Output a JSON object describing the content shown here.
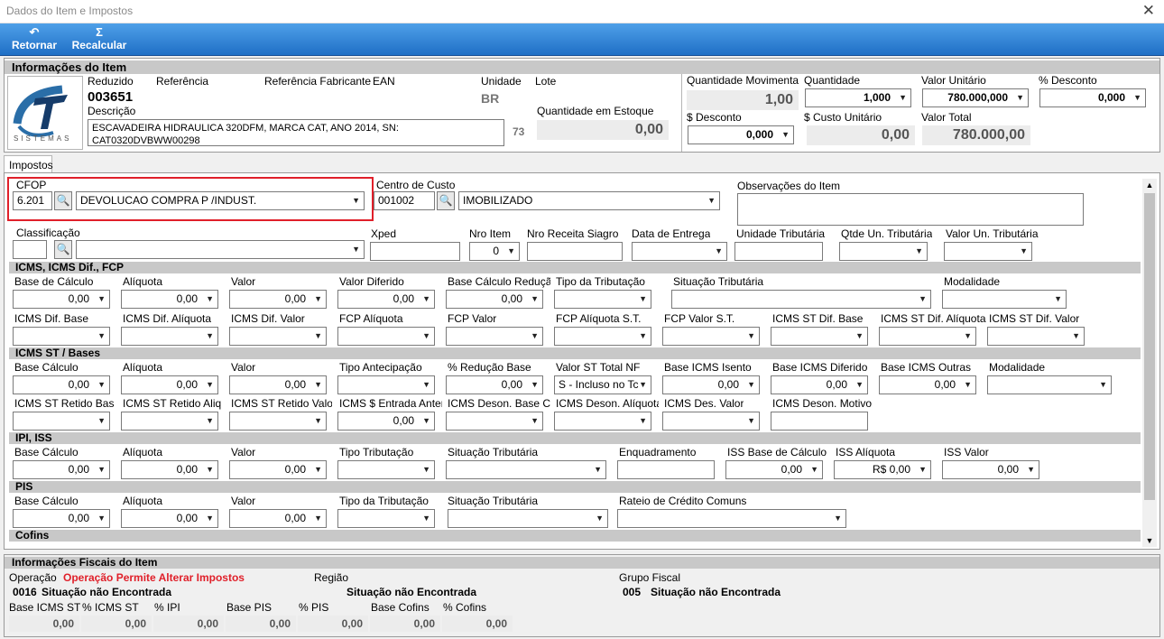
{
  "window": {
    "title": "Dados do Item e Impostos",
    "close": "✕"
  },
  "toolbar": {
    "retornar": "Retornar",
    "recalcular": "Recalcular"
  },
  "item": {
    "header": "Informações do Item",
    "logo_text": "SISTEMAS",
    "reduzido_label": "Reduzido",
    "reduzido": "003651",
    "referencia_label": "Referência",
    "ref_fab_label": "Referência Fabricante",
    "ean_label": "EAN",
    "unidade_label": "Unidade",
    "unidade": "BR",
    "lote_label": "Lote",
    "descricao_label": "Descrição",
    "descricao": "ESCAVADEIRA HIDRAULICA 320DFM, MARCA CAT, ANO 2014, SN: CAT0320DVBWW00298",
    "desc_count": "73",
    "qtd_estoque_label": "Quantidade em Estoque",
    "qtd_estoque": "0,00"
  },
  "values": {
    "qtd_mov_label": "Quantidade Movimenta",
    "qtd_mov": "1,00",
    "qtd_label": "Quantidade",
    "qtd": "1,000",
    "vu_label": "Valor Unitário",
    "vu": "780.000,000",
    "desc_pct_label": "% Desconto",
    "desc_pct": "0,000",
    "desc_val_label": "$ Desconto",
    "desc_val": "0,000",
    "custo_label": "$ Custo Unitário",
    "custo": "0,00",
    "total_label": "Valor Total",
    "total": "780.000,00"
  },
  "tabs": {
    "impostos": "Impostos"
  },
  "top": {
    "cfop_label": "CFOP",
    "cfop_code": "6.201",
    "cfop_desc": "DEVOLUCAO COMPRA P /INDUST.",
    "cc_label": "Centro de Custo",
    "cc_code": "001002",
    "cc_desc": "IMOBILIZADO",
    "obs_label": "Observações do Item",
    "class_label": "Classificação",
    "xped_label": "Xped",
    "nro_item_label": "Nro Item",
    "nro_item": "0",
    "nro_rec_label": "Nro Receita Siagro",
    "data_ent_label": "Data de Entrega",
    "un_trib_label": "Unidade Tributária",
    "qtde_un_trib_label": "Qtde Un. Tributária",
    "valor_un_trib_label": "Valor Un. Tributária"
  },
  "icms": {
    "title": "ICMS, ICMS Dif., FCP",
    "base_label": "Base de Cálculo",
    "base": "0,00",
    "aliq_label": "Alíquota",
    "aliq": "0,00",
    "valor_label": "Valor",
    "valor": "0,00",
    "vdif_label": "Valor Diferido",
    "vdif": "0,00",
    "bred_label": "Base Cálculo Redução",
    "bred": "0,00",
    "tipo_label": "Tipo da Tributação",
    "sit_label": "Situação Tributária",
    "mod_label": "Modalidade",
    "dbase_label": "ICMS Dif. Base",
    "daliq_label": "ICMS Dif. Alíquota",
    "dvalor_label": "ICMS Dif. Valor",
    "fcpaliq_label": "FCP Alíquota",
    "fcpvalor_label": "FCP Valor",
    "fcpst_aliq_label": "FCP Alíquota S.T.",
    "fcpst_valor_label": "FCP Valor S.T.",
    "stdifbase_label": "ICMS ST Dif. Base",
    "stdifaliq_label": "ICMS ST Dif. Alíquota",
    "stdifvalor_label": "ICMS ST Dif. Valor"
  },
  "icmsst": {
    "title": "ICMS ST / Bases",
    "base_label": "Base Cálculo",
    "base": "0,00",
    "aliq_label": "Alíquota",
    "aliq": "0,00",
    "valor_label": "Valor",
    "valor": "0,00",
    "tipoant_label": "Tipo Antecipação",
    "pred_label": "% Redução Base",
    "pred": "0,00",
    "vstnf_label": "Valor ST Total NF",
    "vstnf": "S - Incluso no Tc",
    "bisento_label": "Base ICMS Isento",
    "bisento": "0,00",
    "bdif_label": "Base ICMS Diferido",
    "bdif": "0,00",
    "boutras_label": "Base ICMS Outras",
    "boutras": "0,00",
    "mod_label": "Modalidade",
    "retbase_label": "ICMS ST Retido Base",
    "retaliq_label": "ICMS ST Retido Aliq.",
    "retvalor_label": "ICMS ST Retido Valor",
    "entant_label": "ICMS $ Entrada Anter",
    "entant": "0,00",
    "desonbase_label": "ICMS Deson. Base Cálc",
    "desonaliq_label": "ICMS Deson. Alíquota",
    "desvalor_label": "ICMS Des. Valor",
    "desonmot_label": "ICMS Deson. Motivo"
  },
  "ipi": {
    "title": "IPI, ISS",
    "base_label": "Base Cálculo",
    "base": "0,00",
    "aliq_label": "Alíquota",
    "aliq": "0,00",
    "valor_label": "Valor",
    "valor": "0,00",
    "tipo_label": "Tipo Tributação",
    "sit_label": "Situação Tributária",
    "enq_label": "Enquadramento",
    "issbase_label": "ISS Base de Cálculo",
    "issbase": "0,00",
    "issaliq_label": "ISS Alíquota",
    "issaliq": "R$ 0,00",
    "issvalor_label": "ISS Valor",
    "issvalor": "0,00"
  },
  "pis": {
    "title": "PIS",
    "base_label": "Base Cálculo",
    "base": "0,00",
    "aliq_label": "Alíquota",
    "aliq": "0,00",
    "valor_label": "Valor",
    "valor": "0,00",
    "tipo_label": "Tipo da Tributação",
    "sit_label": "Situação Tributária",
    "rateio_label": "Rateio de Crédito Comuns"
  },
  "cofins": {
    "title": "Cofins"
  },
  "fiscal": {
    "title": "Informações Fiscais do Item",
    "operacao_label": "Operação",
    "operacao_value": "Operação Permite Alterar Impostos",
    "regiao_label": "Região",
    "grupo_label": "Grupo Fiscal",
    "op_code": "0016",
    "op_sit": "Situação não Encontrada",
    "reg_sit": "Situação não Encontrada",
    "grp_code": "005",
    "grp_sit": "Situação não Encontrada",
    "bicms_label": "Base ICMS ST",
    "bicms": "0,00",
    "picms_label": "% ICMS ST",
    "picms": "0,00",
    "pipi_label": "% IPI",
    "pipi": "0,00",
    "bpis_label": "Base PIS",
    "bpis": "0,00",
    "ppis_label": "% PIS",
    "ppis": "0,00",
    "bcof_label": "Base Cofins",
    "bcof": "0,00",
    "pcof_label": "% Cofins",
    "pcof": "0,00"
  },
  "colors": {
    "toolbar": "#2a7fd4",
    "highlight": "#e0202a",
    "red_text": "#e0202a"
  }
}
